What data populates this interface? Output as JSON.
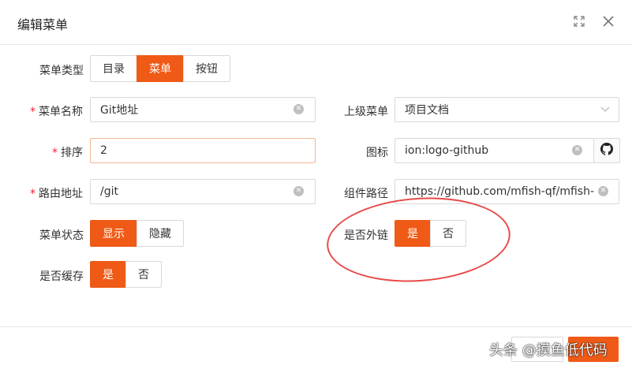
{
  "dialog": {
    "title": "编辑菜单"
  },
  "form": {
    "menu_type": {
      "label": "菜单类型",
      "options": [
        "目录",
        "菜单",
        "按钮"
      ],
      "selected": "菜单"
    },
    "menu_name": {
      "label": "菜单名称",
      "value": "Git地址"
    },
    "parent_menu": {
      "label": "上级菜单",
      "value": "项目文档"
    },
    "sort": {
      "label": "排序",
      "value": "2"
    },
    "icon": {
      "label": "图标",
      "value": "ion:logo-github"
    },
    "route": {
      "label": "路由地址",
      "value": "/git"
    },
    "component": {
      "label": "组件路径",
      "value": "https://github.com/mfish-qf/mfish-noc"
    },
    "menu_status": {
      "label": "菜单状态",
      "options": [
        "显示",
        "隐藏"
      ],
      "selected": "显示"
    },
    "is_external": {
      "label": "是否外链",
      "options": [
        "是",
        "否"
      ],
      "selected": "是"
    },
    "is_cache": {
      "label": "是否缓存",
      "options": [
        "是",
        "否"
      ],
      "selected": "是"
    }
  },
  "watermark": "头条 @摸鱼低代码",
  "colors": {
    "accent": "#ef5a17",
    "annotation": "#e84a4a"
  }
}
